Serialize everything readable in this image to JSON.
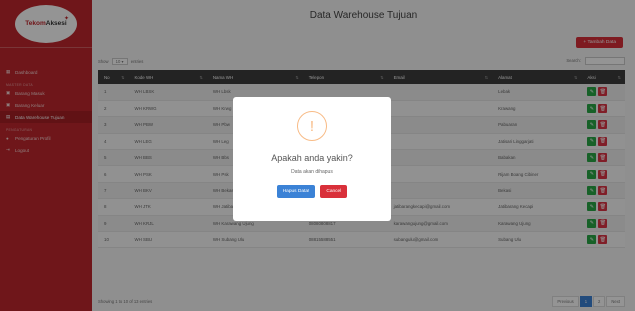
{
  "brand": {
    "name_part1": "Tekom",
    "name_part2": "Aksesi"
  },
  "sidebar": {
    "items": [
      {
        "label": "Dashboard",
        "icon": "grid-icon"
      },
      {
        "section": "MASTER DATA"
      },
      {
        "label": "Barang Masuk",
        "icon": "box-icon"
      },
      {
        "label": "Barang Keluar",
        "icon": "box-icon"
      },
      {
        "label": "Data Warehouse Tujuan",
        "icon": "building-icon",
        "active": true
      },
      {
        "section": "PENGATURAN"
      },
      {
        "label": "Pengaturan Profil",
        "icon": "user-icon"
      },
      {
        "label": "Logout",
        "icon": "logout-icon"
      }
    ]
  },
  "page": {
    "title": "Data Warehouse Tujuan",
    "add_button": "+ Tambah Data",
    "show_prefix": "Show",
    "show_value": "10",
    "show_suffix": "entries",
    "search_label": "Search:"
  },
  "table": {
    "columns": [
      "No",
      "Kode WH",
      "Nama WH",
      "Telepon",
      "Email",
      "Alamat",
      "Aksi"
    ],
    "rows": [
      [
        "1",
        "WH LBSK",
        "WH Lbsk",
        "",
        "",
        "Lebak",
        ""
      ],
      [
        "2",
        "WH KRWG",
        "WH Krwg",
        "",
        "",
        "Krawang",
        ""
      ],
      [
        "3",
        "WH PBW",
        "WH Pbw",
        "",
        "",
        "Pabuaran",
        ""
      ],
      [
        "4",
        "WH LEG",
        "WH Leg",
        "",
        "",
        "Jatisari Linggarjati",
        ""
      ],
      [
        "5",
        "WH BBS",
        "WH Bbs",
        "",
        "",
        "Babakan",
        ""
      ],
      [
        "6",
        "WH PSK",
        "WH Psk",
        "",
        "",
        "Rijam Boang Cibiner",
        ""
      ],
      [
        "7",
        "WH BKV",
        "WH Bekasi",
        "",
        "",
        "Bekasi",
        ""
      ],
      [
        "8",
        "WH JTK",
        "WH Jatibarang Kecapi",
        "08081717177",
        "jatibarangkecapi@gmail.com",
        "Jatibarang Kecapi",
        ""
      ],
      [
        "9",
        "WH KRJL",
        "WH Karawang Ujung",
        "08080808817",
        "karawangujung@gmail.com",
        "Karawang Ujung",
        ""
      ],
      [
        "10",
        "WH SBU",
        "WH Subang Ulu",
        "08815588551",
        "subangulu@gmail.com",
        "Subang Ulu",
        ""
      ]
    ]
  },
  "footer": {
    "info": "Showing 1 to 10 of 13 entries",
    "previous": "Previous",
    "pages": [
      "1",
      "2"
    ],
    "next": "Next"
  },
  "modal": {
    "icon": "warning-icon",
    "title": "Apakah anda yakin?",
    "text": "Data akan dihapus",
    "confirm": "Hapus Data!",
    "cancel": "Cancel"
  },
  "colors": {
    "sidebar": "#c0272d",
    "primary": "#3b82d6",
    "danger": "#dc3545",
    "success": "#28a745",
    "warning": "#f8bb86"
  }
}
